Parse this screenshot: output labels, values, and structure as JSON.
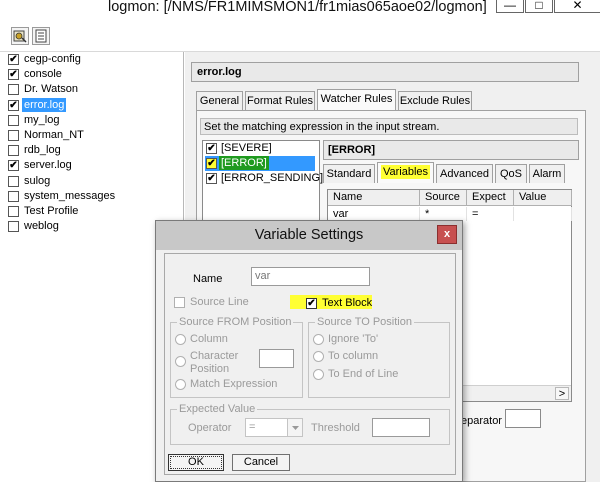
{
  "window": {
    "title": "logmon: [/NMS/FR1MIMSMON1/fr1mias065aoe02/logmon]",
    "min_glyph": "—",
    "max_glyph": "□",
    "close_glyph": "✕"
  },
  "toolbar": {
    "icons": [
      "settings-icon",
      "document-icon"
    ]
  },
  "tree": {
    "items": [
      {
        "label": "cegp-config",
        "checked": true,
        "selected": false
      },
      {
        "label": "console",
        "checked": true,
        "selected": false
      },
      {
        "label": "Dr. Watson",
        "checked": false,
        "selected": false
      },
      {
        "label": "error.log",
        "checked": true,
        "selected": true
      },
      {
        "label": "my_log",
        "checked": false,
        "selected": false
      },
      {
        "label": "Norman_NT",
        "checked": false,
        "selected": false
      },
      {
        "label": "rdb_log",
        "checked": false,
        "selected": false
      },
      {
        "label": "server.log",
        "checked": true,
        "selected": false
      },
      {
        "label": "sulog",
        "checked": false,
        "selected": false
      },
      {
        "label": "system_messages",
        "checked": false,
        "selected": false
      },
      {
        "label": "Test Profile",
        "checked": false,
        "selected": false
      },
      {
        "label": "weblog",
        "checked": false,
        "selected": false
      }
    ]
  },
  "header": {
    "title": "error.log"
  },
  "main_tabs": [
    "General",
    "Format Rules",
    "Watcher Rules",
    "Exclude Rules"
  ],
  "active_main_tab": "Watcher Rules",
  "hint": "Set the matching expression in the input stream.",
  "expressions": [
    {
      "label": "[SEVERE]",
      "checked": true,
      "selected": false
    },
    {
      "label": "[ERROR]",
      "checked": true,
      "selected": true
    },
    {
      "label": "[ERROR_SENDING]",
      "checked": true,
      "selected": false
    }
  ],
  "detail": {
    "title": "[ERROR]",
    "tabs": [
      "Standard",
      "Variables",
      "Advanced",
      "QoS",
      "Alarm"
    ],
    "active_tab": "Variables",
    "columns": [
      "Name",
      "Source",
      "Expect",
      "Value"
    ],
    "rows": [
      {
        "name": "var",
        "source": "*",
        "expect": "=",
        "value": ""
      }
    ],
    "separator_label": "eparator",
    "scroll_arrow": ">"
  },
  "dialog": {
    "title": "Variable Settings",
    "close_glyph": "x",
    "name_label": "Name",
    "name_value": "var",
    "source_line_label": "Source Line",
    "text_block_label": "Text Block",
    "text_block_checked": true,
    "from_group": {
      "title": "Source FROM Position",
      "options": [
        "Column",
        "Character Position",
        "Match Expression"
      ],
      "char_pos_line1": "Character",
      "char_pos_line2": "Position"
    },
    "to_group": {
      "title": "Source TO Position",
      "options": [
        "Ignore 'To'",
        "To column",
        "To End of Line"
      ]
    },
    "expected_group": {
      "title": "Expected Value",
      "operator_label": "Operator",
      "operator_value": "=",
      "threshold_label": "Threshold",
      "threshold_value": ""
    },
    "ok_label": "OK",
    "cancel_label": "Cancel"
  },
  "colors": {
    "selection": "#3399ff",
    "highlight": "#ffff33",
    "green_highlight": "#1f9a1f",
    "dialog_close": "#c75050"
  }
}
